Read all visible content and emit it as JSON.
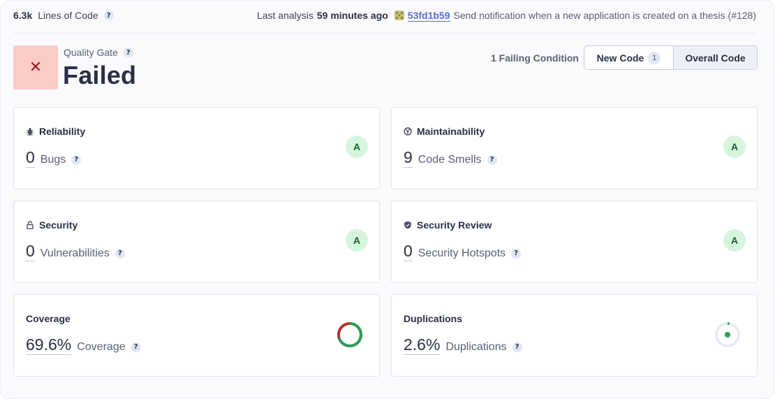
{
  "topbar": {
    "lines_of_code_value": "6.3k",
    "lines_of_code_label": "Lines of Code",
    "last_analysis_label": "Last analysis",
    "last_analysis_time": "59 minutes ago",
    "commit_hash": "53fd1b59",
    "commit_message": "Send notification when a new application is created on a thesis (#128)"
  },
  "quality_gate": {
    "icon": "close-icon",
    "label": "Quality Gate",
    "status": "Failed",
    "status_color": "#fbcbc6"
  },
  "failing_conditions": "1 Failing Condition",
  "toggle": {
    "new_code_label": "New Code",
    "new_code_count": "1",
    "overall_code_label": "Overall Code",
    "selected": "Overall Code"
  },
  "cards": {
    "reliability": {
      "title": "Reliability",
      "icon": "bug-icon",
      "value": "0",
      "label": "Bugs",
      "rating": "A"
    },
    "maintainability": {
      "title": "Maintainability",
      "icon": "maintainability-icon",
      "value": "9",
      "label": "Code Smells",
      "rating": "A"
    },
    "security": {
      "title": "Security",
      "icon": "lock-icon",
      "value": "0",
      "label": "Vulnerabilities",
      "rating": "A"
    },
    "security_review": {
      "title": "Security Review",
      "icon": "shield-icon",
      "value": "0",
      "label": "Security Hotspots",
      "rating": "A"
    },
    "coverage": {
      "title": "Coverage",
      "value": "69.6%",
      "label": "Coverage",
      "percent": 69.6
    },
    "duplications": {
      "title": "Duplications",
      "value": "2.6%",
      "label": "Duplications",
      "percent": 2.6
    }
  },
  "colors": {
    "rating_a_bg": "#d6f5dd",
    "coverage_good": "#2d9d5a",
    "coverage_bad": "#b5302b",
    "link": "#5d6cd0"
  }
}
